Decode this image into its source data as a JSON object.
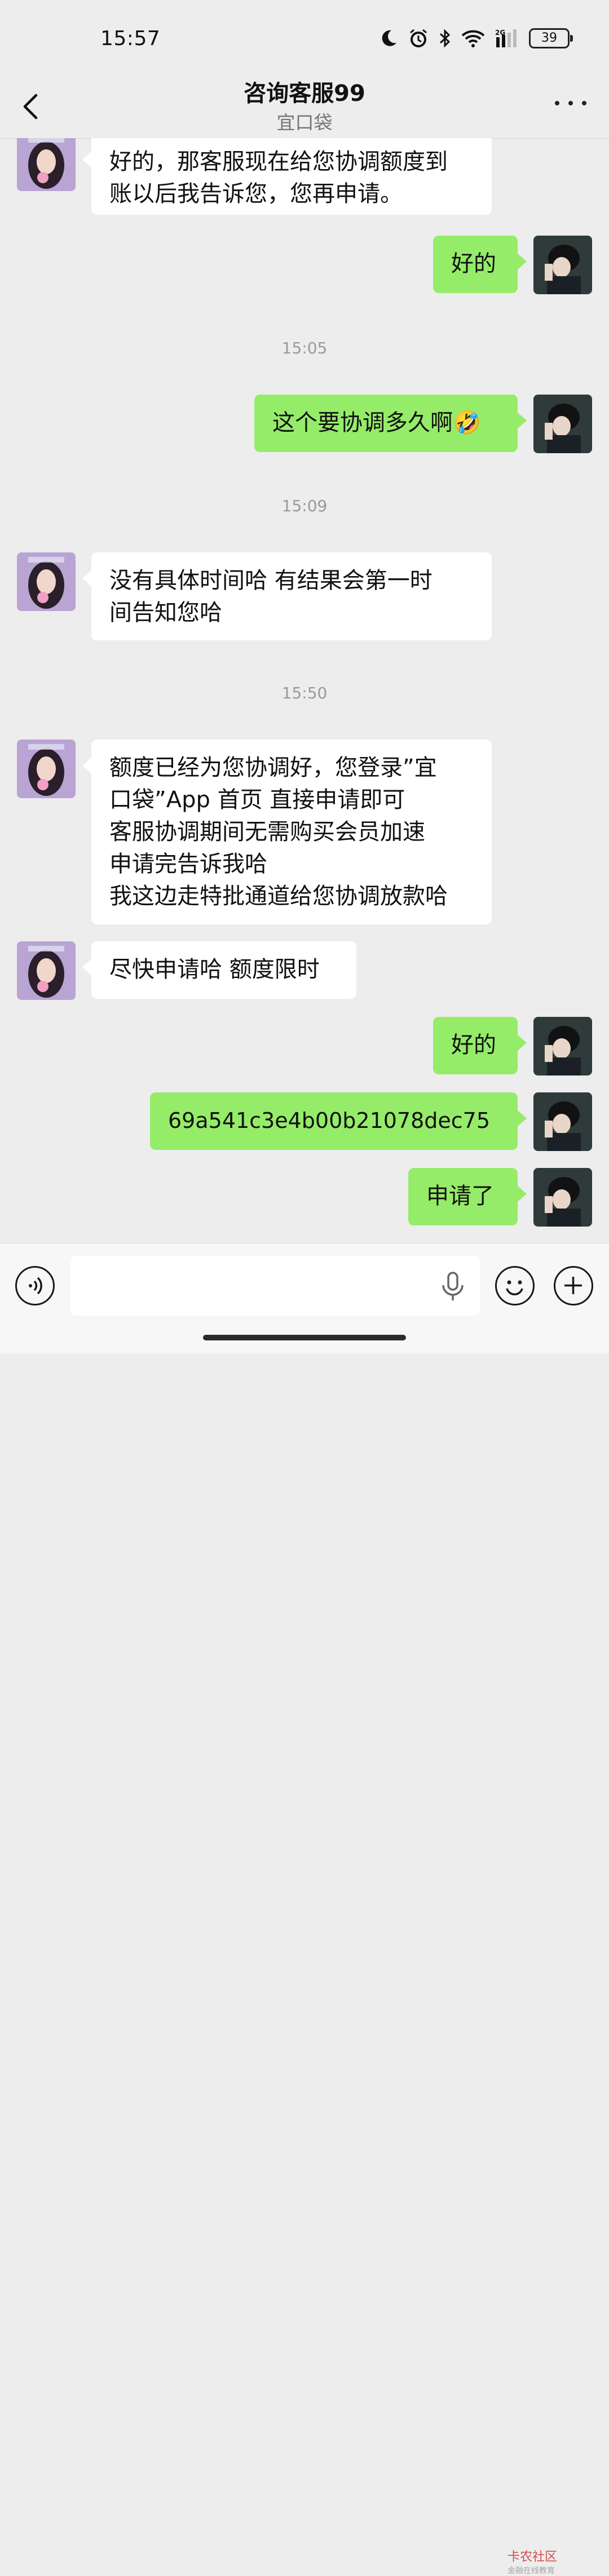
{
  "status_bar": {
    "time": "15:57",
    "battery": "39",
    "network": "2G"
  },
  "header": {
    "title": "咨询客服99",
    "subtitle": "宜口袋"
  },
  "messages": [
    {
      "dir": "in",
      "text": "好的，那客服现在给您协调额度到\n账以后我告诉您，您再申请。"
    },
    {
      "dir": "out",
      "text": "好的"
    },
    {
      "ts": "15:05"
    },
    {
      "dir": "out",
      "text": "这个要协调多久啊🤣"
    },
    {
      "ts": "15:09"
    },
    {
      "dir": "in",
      "text": "没有具体时间哈  有结果会第一时\n间告知您哈"
    },
    {
      "ts": "15:50"
    },
    {
      "dir": "in",
      "text": "额度已经为您协调好，您登录”宜\n口袋”App 首页  直接申请即可\n客服协调期间无需购买会员加速\n申请完告诉我哈\n我这边走特批通道给您协调放款哈"
    },
    {
      "dir": "in",
      "text": "尽快申请哈 额度限时"
    },
    {
      "dir": "out",
      "text": "好的"
    },
    {
      "dir": "out",
      "text": "69a541c3e4b00b21078dec75"
    },
    {
      "dir": "out",
      "text": "申请了"
    }
  ],
  "input": {
    "placeholder": ""
  },
  "watermark": {
    "name": "卡农社区",
    "tagline": "金融在线教育"
  },
  "colors": {
    "background": "#ededed",
    "out_bubble": "#95ec69",
    "in_bubble": "#ffffff"
  },
  "icons": {
    "voice": "voice-toggle-icon",
    "mic": "microphone-icon",
    "emoji": "emoji-icon",
    "plus": "plus-icon",
    "back": "chevron-left-icon",
    "more": "more-dots-icon"
  }
}
